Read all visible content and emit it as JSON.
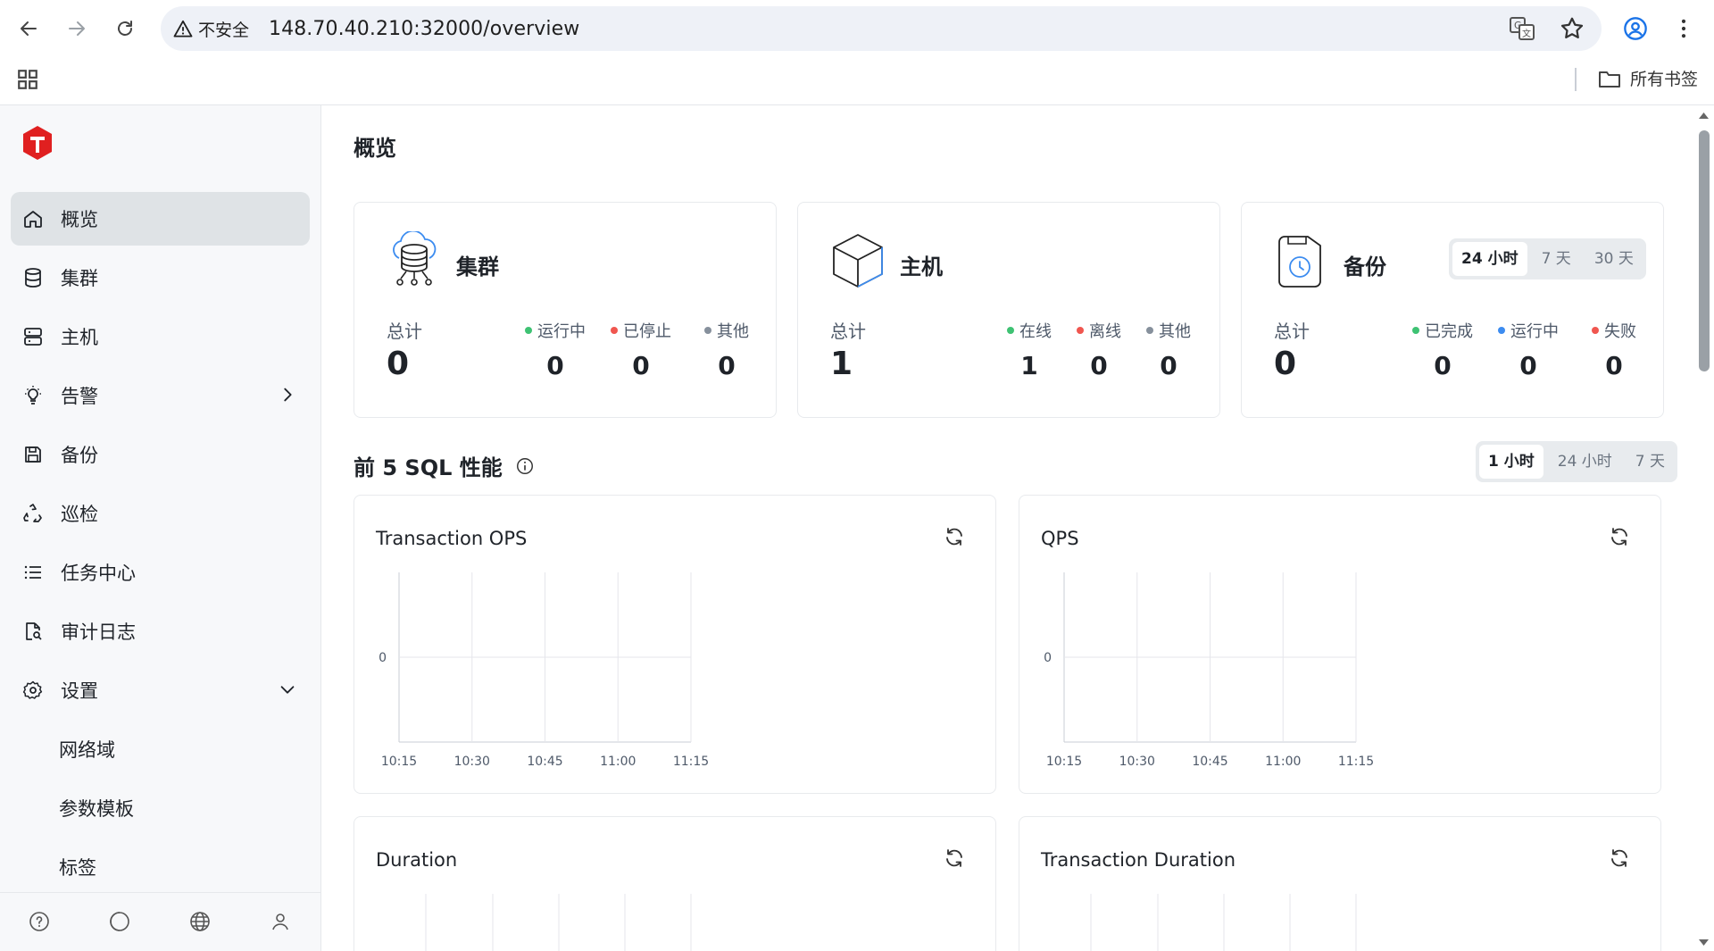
{
  "browser": {
    "security_label": "不安全",
    "url": "148.70.40.210:32000/overview",
    "bookmarks_folder": "所有书签"
  },
  "sidebar": {
    "items": [
      {
        "label": "概览",
        "icon": "home-icon",
        "active": true
      },
      {
        "label": "集群",
        "icon": "database-icon"
      },
      {
        "label": "主机",
        "icon": "server-icon"
      },
      {
        "label": "告警",
        "icon": "bulb-icon",
        "chevron": "right"
      },
      {
        "label": "备份",
        "icon": "save-icon"
      },
      {
        "label": "巡检",
        "icon": "recycle-icon"
      },
      {
        "label": "任务中心",
        "icon": "list-icon"
      },
      {
        "label": "审计日志",
        "icon": "file-search-icon"
      },
      {
        "label": "设置",
        "icon": "gear-icon",
        "chevron": "down"
      }
    ],
    "subitems": [
      "网络域",
      "参数模板",
      "标签"
    ]
  },
  "main": {
    "title": "概览",
    "cards": {
      "cluster": {
        "title": "集群",
        "total_label": "总计",
        "total": "0",
        "stats": [
          {
            "label": "运行中",
            "value": "0",
            "color": "#3ec273"
          },
          {
            "label": "已停止",
            "value": "0",
            "color": "#f0564f"
          },
          {
            "label": "其他",
            "value": "0",
            "color": "#86909c"
          }
        ]
      },
      "host": {
        "title": "主机",
        "total_label": "总计",
        "total": "1",
        "stats": [
          {
            "label": "在线",
            "value": "1",
            "color": "#3ec273"
          },
          {
            "label": "离线",
            "value": "0",
            "color": "#f0564f"
          },
          {
            "label": "其他",
            "value": "0",
            "color": "#86909c"
          }
        ]
      },
      "backup": {
        "title": "备份",
        "total_label": "总计",
        "total": "0",
        "ranges": [
          "24 小时",
          "7 天",
          "30 天"
        ],
        "stats": [
          {
            "label": "已完成",
            "value": "0",
            "color": "#3ec273"
          },
          {
            "label": "运行中",
            "value": "0",
            "color": "#3c8cf0"
          },
          {
            "label": "失败",
            "value": "0",
            "color": "#f0564f"
          }
        ]
      }
    },
    "sql_section": {
      "title": "前 5 SQL 性能",
      "ranges": [
        "1 小时",
        "24 小时",
        "7 天"
      ]
    }
  },
  "chart_data": [
    {
      "type": "line",
      "title": "Transaction OPS",
      "x": [
        "10:15",
        "10:30",
        "10:45",
        "11:00",
        "11:15"
      ],
      "y_ticks": [
        "0"
      ],
      "series": []
    },
    {
      "type": "line",
      "title": "QPS",
      "x": [
        "10:15",
        "10:30",
        "10:45",
        "11:00",
        "11:15"
      ],
      "y_ticks": [
        "0"
      ],
      "series": []
    },
    {
      "type": "line",
      "title": "Duration",
      "x": [],
      "series": []
    },
    {
      "type": "line",
      "title": "Transaction Duration",
      "x": [],
      "series": []
    }
  ]
}
